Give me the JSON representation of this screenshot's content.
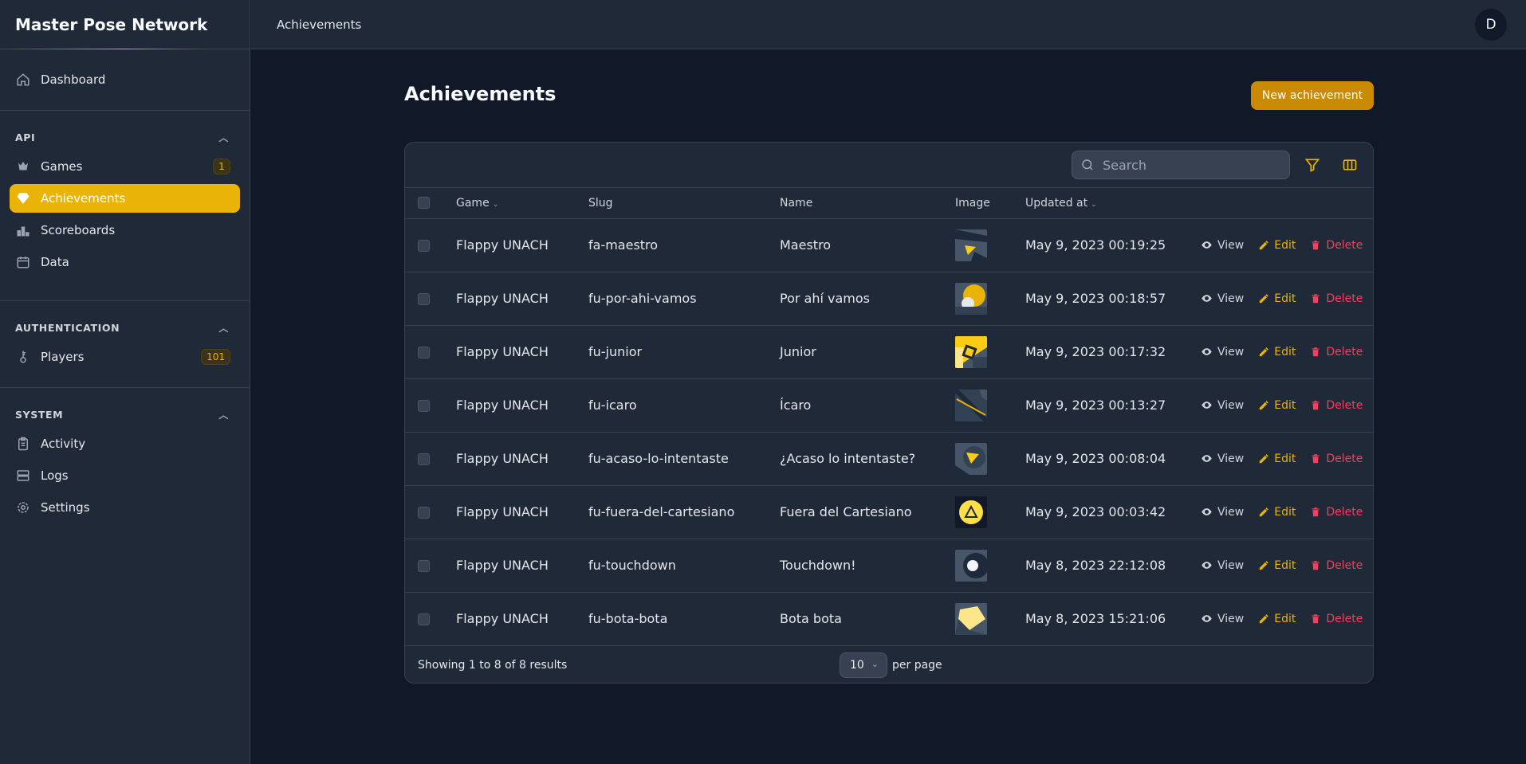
{
  "app": {
    "title": "Master Pose Network",
    "avatar_initial": "D"
  },
  "topbar": {
    "breadcrumb": "Achievements"
  },
  "sidebar": {
    "dashboard": "Dashboard",
    "groups": [
      {
        "label": "API",
        "items": [
          {
            "label": "Games",
            "badge": "1",
            "icon": "trophy-icon"
          },
          {
            "label": "Achievements",
            "icon": "gem-icon",
            "active": true
          },
          {
            "label": "Scoreboards",
            "icon": "podium-icon"
          },
          {
            "label": "Data",
            "icon": "calendar-data-icon"
          }
        ]
      },
      {
        "label": "AUTHENTICATION",
        "items": [
          {
            "label": "Players",
            "badge": "101",
            "icon": "key-icon"
          }
        ]
      },
      {
        "label": "SYSTEM",
        "items": [
          {
            "label": "Activity",
            "icon": "clipboard-icon"
          },
          {
            "label": "Logs",
            "icon": "server-icon"
          },
          {
            "label": "Settings",
            "icon": "cog-icon"
          }
        ]
      }
    ]
  },
  "page": {
    "title": "Achievements",
    "new_button": "New achievement"
  },
  "search": {
    "placeholder": "Search"
  },
  "table": {
    "columns": {
      "game": "Game",
      "slug": "Slug",
      "name": "Name",
      "image": "Image",
      "updated": "Updated at"
    },
    "actions": {
      "view": "View",
      "edit": "Edit",
      "delete": "Delete"
    },
    "rows": [
      {
        "game": "Flappy UNACH",
        "slug": "fa-maestro",
        "name": "Maestro",
        "updated": "May 9, 2023 00:19:25"
      },
      {
        "game": "Flappy UNACH",
        "slug": "fu-por-ahi-vamos",
        "name": "Por ahí vamos",
        "updated": "May 9, 2023 00:18:57"
      },
      {
        "game": "Flappy UNACH",
        "slug": "fu-junior",
        "name": "Junior",
        "updated": "May 9, 2023 00:17:32"
      },
      {
        "game": "Flappy UNACH",
        "slug": "fu-icaro",
        "name": "Ícaro",
        "updated": "May 9, 2023 00:13:27"
      },
      {
        "game": "Flappy UNACH",
        "slug": "fu-acaso-lo-intentaste",
        "name": "¿Acaso lo intentaste?",
        "updated": "May 9, 2023 00:08:04"
      },
      {
        "game": "Flappy UNACH",
        "slug": "fu-fuera-del-cartesiano",
        "name": "Fuera del Cartesiano",
        "updated": "May 9, 2023 00:03:42"
      },
      {
        "game": "Flappy UNACH",
        "slug": "fu-touchdown",
        "name": "Touchdown!",
        "updated": "May 8, 2023 22:12:08"
      },
      {
        "game": "Flappy UNACH",
        "slug": "fu-bota-bota",
        "name": "Bota bota",
        "updated": "May 8, 2023 15:21:06"
      }
    ]
  },
  "footer": {
    "showing": "Showing 1 to 8 of 8 results",
    "per_page_value": "10",
    "per_page_label": "per page"
  },
  "colors": {
    "accent": "#eab308",
    "danger": "#f43f5e",
    "background": "#111827",
    "surface": "#1f2937"
  }
}
